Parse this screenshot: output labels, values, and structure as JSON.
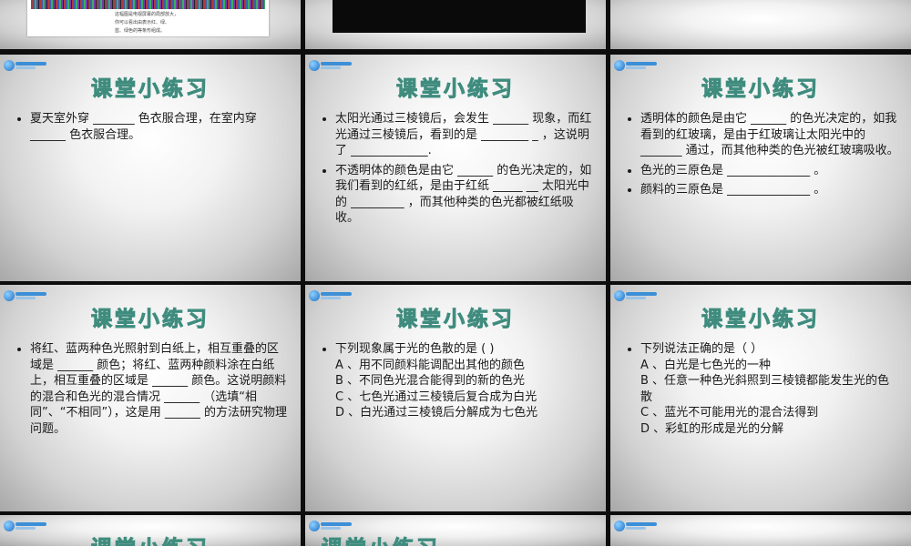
{
  "top_row": {
    "left_note_lines": [
      "这幅图是电视屏幕的局部放大，",
      "你可以看出由表示红、绿、",
      "蓝、绿色的等条形组成。"
    ]
  },
  "slides": [
    {
      "title": "课堂小练习",
      "items": [
        {
          "text": "夏天室外穿 _______ 色衣服合理，在室内穿 ______ 色衣服合理。"
        }
      ]
    },
    {
      "title": "课堂小练习",
      "items": [
        {
          "text": "太阳光通过三棱镜后，会发生 ______ 现象，而红光通过三棱镜后，看到的是 ________ _ ，这说明了 _____________."
        },
        {
          "text": "不透明体的颜色是由它 ______ 的色光决定的，如我们看到的红纸，是由于红纸 _____ __ 太阳光中的 _________ ，而其他种类的色光都被红纸吸收。"
        }
      ]
    },
    {
      "title": "课堂小练习",
      "items": [
        {
          "text": "透明体的颜色是由它 ______ 的色光决定的，如我看到的红玻璃，是由于红玻璃让太阳光中的 _______ 通过，而其他种类的色光被红玻璃吸收。"
        },
        {
          "text": "色光的三原色是 ______________ 。"
        },
        {
          "text": "颜料的三原色是 ______________ 。"
        }
      ]
    },
    {
      "title": "课堂小练习",
      "items": [
        {
          "text": "将红、蓝两种色光照射到白纸上，相互重叠的区域是 ______ 颜色；将红、蓝两种颜料涂在白纸上，相互重叠的区域是 ______ 颜色。这说明颜料的混合和色光的混合情况 ______ （选填“相同”、“不相同”），这是用 ______ 的方法研究物理问题。"
        }
      ]
    },
    {
      "title": "课堂小练习",
      "items": [
        {
          "text": "下列现象属于光的色散的是 (     )",
          "options": [
            "A 、用不同颜料能调配出其他的颜色",
            "B 、不同色光混合能得到的新的色光",
            "C 、七色光通过三棱镜后复合成为白光",
            "D 、白光通过三棱镜后分解成为七色光"
          ]
        }
      ]
    },
    {
      "title": "课堂小练习",
      "items": [
        {
          "text": "下列说法正确的是（         ）",
          "options": [
            "A 、白光是七色光的一种",
            "B 、任意一种色光斜照到三棱镜都能发生光的色散",
            "C 、蓝光不可能用光的混合法得到",
            "D 、彩虹的形成是光的分解"
          ]
        }
      ]
    }
  ],
  "bottom_row": [
    {
      "title": "课堂小练习"
    },
    {
      "title": "课堂小练习"
    },
    {
      "title": ""
    }
  ]
}
